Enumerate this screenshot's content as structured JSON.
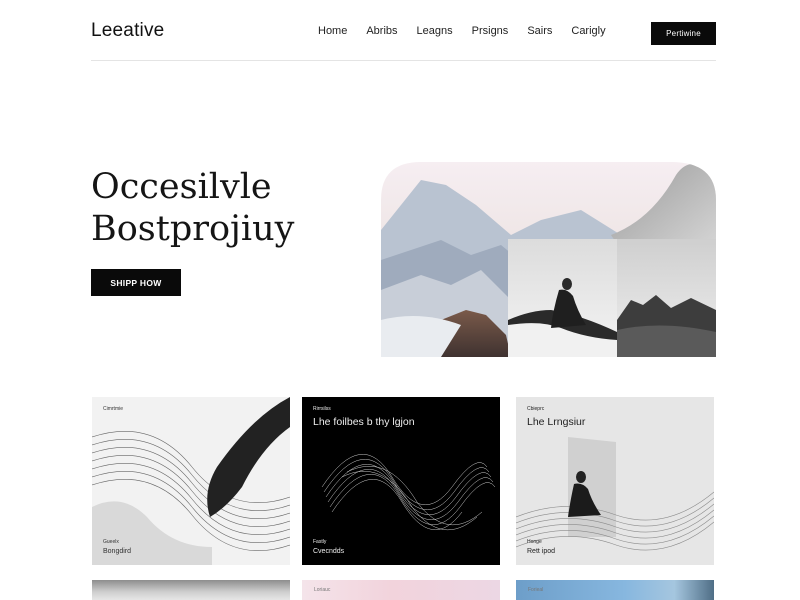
{
  "header": {
    "logo": "Leeative",
    "nav": [
      "Home",
      "Abribs",
      "Leagns",
      "Prsigns",
      "Sairs",
      "Carigly"
    ],
    "cta": "Pertiwine"
  },
  "hero": {
    "title_line1": "Occesilvle",
    "title_line2": "Bostprojiuy",
    "button": "SHIPP HOW"
  },
  "cards": [
    {
      "tag": "Cimrtmie",
      "title": "",
      "foot1": "Gueelx",
      "foot2": "Bongdird"
    },
    {
      "tag": "Rirrsilss",
      "title": "Lhe foilbes b thy lgjon",
      "foot1": "Fastly",
      "foot2": "Cvecndds"
    },
    {
      "tag": "Cbieprc",
      "title": "Lhe Lrngsiur",
      "foot1": "Honge",
      "foot2": "Rett ipod"
    }
  ],
  "bottom_cards": [
    {
      "tag": ""
    },
    {
      "tag": "Loriauc"
    },
    {
      "tag": "Forieal"
    }
  ],
  "colors": {
    "accent": "#0a0a0a",
    "background": "#ffffff",
    "rule": "#e4e4e4"
  }
}
